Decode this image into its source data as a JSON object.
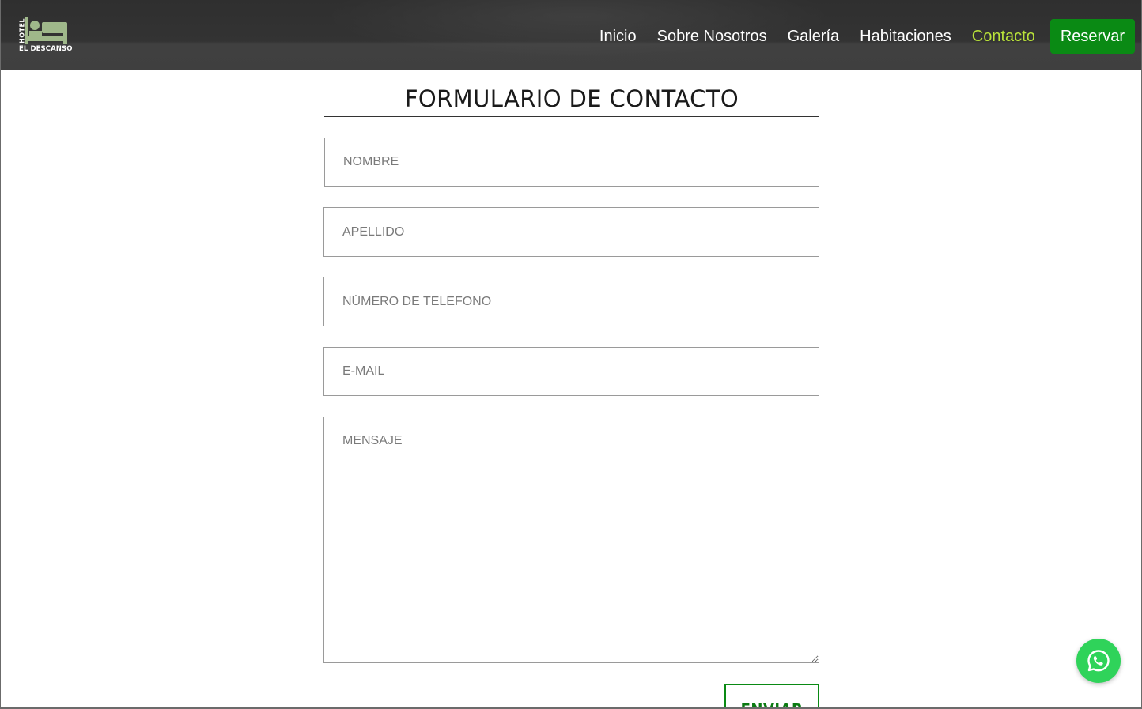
{
  "brand": {
    "vertical_text": "HOTEL",
    "name": "EL DESCANSO",
    "logo_icon": "bed-icon",
    "logo_color": "#9fb88a"
  },
  "nav": {
    "items": [
      {
        "label": "Inicio",
        "active": false
      },
      {
        "label": "Sobre Nosotros",
        "active": false
      },
      {
        "label": "Galería",
        "active": false
      },
      {
        "label": "Habitaciones",
        "active": false
      },
      {
        "label": "Contacto",
        "active": true
      }
    ],
    "reserve_label": "Reservar",
    "active_color": "#b9e23a",
    "reserve_color": "#0a8a14"
  },
  "form": {
    "title": "FORMULARIO DE CONTACTO",
    "fields": {
      "nombre": {
        "placeholder": "NOMBRE",
        "value": ""
      },
      "apellido": {
        "placeholder": "APELLIDO",
        "value": ""
      },
      "telefono": {
        "placeholder": "NÚMERO DE TELEFONO",
        "value": ""
      },
      "email": {
        "placeholder": "E-MAIL",
        "value": ""
      },
      "mensaje": {
        "placeholder": "MENSAJE",
        "value": ""
      }
    },
    "submit_label": "ENVIAR"
  },
  "floating": {
    "whatsapp_icon": "whatsapp-icon",
    "color": "#2fd35a"
  }
}
